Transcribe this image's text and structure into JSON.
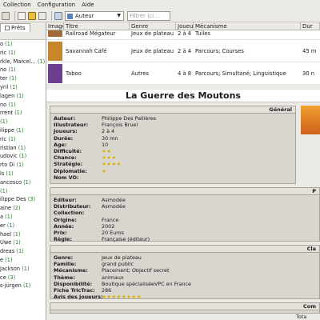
{
  "menu": [
    "Collection",
    "Configuration",
    "Aide"
  ],
  "toolbar": {
    "combo_value": "Auteur",
    "filter_placeholder": "Filtrer ici..."
  },
  "left": {
    "tab_label": "Prêts",
    "rows": [
      {
        "name": "o",
        "count": "(1)"
      },
      {
        "name": "ric",
        "count": "(1)"
      },
      {
        "name": "rkle, Marcel...",
        "count": "(1)"
      },
      {
        "name": "no",
        "count": "(1)"
      },
      {
        "name": "ter",
        "count": "(1)"
      },
      {
        "name": "yril",
        "count": "(1)"
      },
      {
        "name": "lagen",
        "count": "(1)"
      },
      {
        "name": "no",
        "count": "(1)"
      },
      {
        "name": "rrent",
        "count": "(1)"
      },
      {
        "name": "",
        "count": "(1)"
      },
      {
        "name": "ilippe",
        "count": "(1)"
      },
      {
        "name": "ric",
        "count": "(1)"
      },
      {
        "name": "ristian",
        "count": "(1)"
      },
      {
        "name": "udovic",
        "count": "(1)"
      },
      {
        "name": "rto Di",
        "count": "(1)"
      },
      {
        "name": "ls",
        "count": "(1)"
      },
      {
        "name": "ancesco",
        "count": "(1)"
      },
      {
        "name": "",
        "count": "(1)"
      },
      {
        "name": "ilippe Des",
        "count": "(3)"
      },
      {
        "name": "aine",
        "count": "(2)"
      },
      {
        "name": "a",
        "count": "(1)"
      },
      {
        "name": "er",
        "count": "(1)"
      },
      {
        "name": "hael",
        "count": "(1)"
      },
      {
        "name": "Uwe",
        "count": "(1)"
      },
      {
        "name": "dreas",
        "count": "(1)"
      },
      {
        "name": "e",
        "count": "(1)"
      },
      {
        "name": "Jackson",
        "count": "(1)"
      },
      {
        "name": "ce",
        "count": "(3)"
      },
      {
        "name": "s-jürgen",
        "count": "(1)"
      }
    ]
  },
  "grid": {
    "headers": [
      "Image",
      "Titre",
      "Genre",
      "Joueurs",
      "Mécanisme",
      "Dur"
    ],
    "rows": [
      {
        "title": "Railroad Mégateur",
        "genre": "Jeux de plateau",
        "joueurs": "2 à 4",
        "meca": "Tuiles",
        "duree": "",
        "thumb": "#a06a3a"
      },
      {
        "title": "Savannah Café",
        "genre": "Jeux de plateau",
        "joueurs": "2 à 4",
        "meca": "Parcours; Courses",
        "duree": "45 m",
        "thumb": "#c8862c"
      },
      {
        "title": "Taboo",
        "genre": "Autres",
        "joueurs": "4 à 8",
        "meca": "Parcours; Simultané; Linguistique",
        "duree": "30 n",
        "thumb": "#6a3f8f"
      }
    ]
  },
  "detail": {
    "title": "La Guerre des Moutons",
    "general": {
      "head": "Général",
      "fields": [
        {
          "k": "Auteur:",
          "v": "Philippe Des Pallières"
        },
        {
          "k": "Illustrateur:",
          "v": "François Bruel"
        },
        {
          "k": "Joueurs:",
          "v": "2 à 4"
        },
        {
          "k": "Durée:",
          "v": "30 mn"
        },
        {
          "k": "Age:",
          "v": "10"
        },
        {
          "k": "Difficulté:",
          "v": "★★"
        },
        {
          "k": "Chance:",
          "v": "★★★"
        },
        {
          "k": "Stratégie:",
          "v": "★★★★"
        },
        {
          "k": "Diplomatie:",
          "v": "★"
        },
        {
          "k": "Nom VO:",
          "v": ""
        }
      ]
    },
    "publishing": {
      "head": "P",
      "fields": [
        {
          "k": "Editeur:",
          "v": "Asmodée"
        },
        {
          "k": "Distributeur:",
          "v": "Asmodée"
        },
        {
          "k": "Collection:",
          "v": ""
        },
        {
          "k": "Origine:",
          "v": "France"
        },
        {
          "k": "Année:",
          "v": "2002"
        },
        {
          "k": "Prix:",
          "v": "20 Euros"
        },
        {
          "k": "Règle:",
          "v": "Française (éditeur)"
        }
      ]
    },
    "classification": {
      "head": "Cla",
      "fields": [
        {
          "k": "Genre:",
          "v": "Jeux de plateau"
        },
        {
          "k": "Famille:",
          "v": "grand public"
        },
        {
          "k": "Mécanisme:",
          "v": "Placement; Objectif secret"
        },
        {
          "k": "Thème:",
          "v": "animaux"
        },
        {
          "k": "Disponibilité:",
          "v": "Boutique spécialiséeVPC en France"
        },
        {
          "k": "Fiche TricTrac:",
          "v": "286"
        },
        {
          "k": "Avis des joueurs:",
          "v": "★★★★★★★★"
        }
      ]
    },
    "comments_head": "Com",
    "total_label": "Tota"
  },
  "colors": {
    "accent": "#2b7a2b",
    "stars": "#d8b100",
    "cover": "#e07a1a"
  }
}
